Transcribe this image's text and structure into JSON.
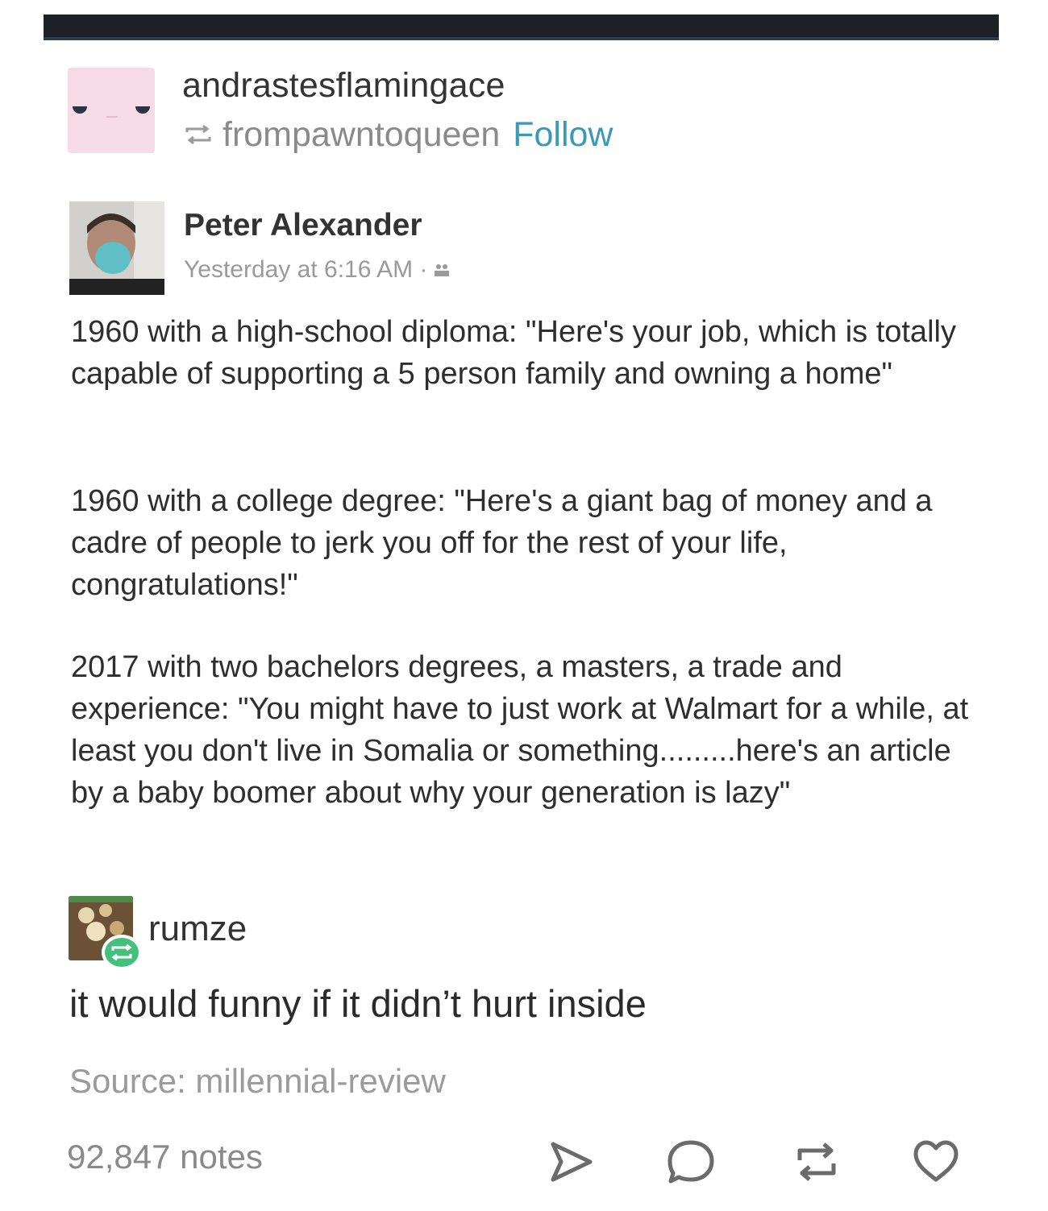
{
  "header": {
    "blog_name": "andrastesflamingace",
    "reblogged_from": "frompawntoqueen",
    "follow_label": "Follow"
  },
  "fb_post": {
    "author": "Peter Alexander",
    "timestamp": "Yesterday at 6:16 AM ·",
    "paragraphs": [
      "1960 with a high-school diploma: \"Here's your job, which is totally capable of supporting a 5 person family and owning a home\"",
      "1960 with a college degree: \"Here's a giant bag of money and a cadre of people to jerk you off for the rest of your life, congratulations!\"",
      "2017 with two bachelors degrees, a masters, a trade and experience: \"You might have to just work at Walmart for a while, at least you don't live in Somalia or something.........here's an article by a baby boomer about why your generation is lazy\""
    ]
  },
  "reblog": {
    "username": "rumze",
    "comment": "it would funny if it didn’t hurt inside"
  },
  "source": "Source: millennial-review",
  "footer": {
    "notes": "92,847 notes"
  },
  "icons": {
    "reblog": "reblog-icon",
    "friends": "friends-icon",
    "share": "share-icon",
    "reply": "reply-icon",
    "like": "heart-icon"
  },
  "colors": {
    "follow": "#3b99b6",
    "reblog_badge": "#44c07c",
    "avatar_pink": "#f7dbe7",
    "top_bar": "#1d2026"
  }
}
